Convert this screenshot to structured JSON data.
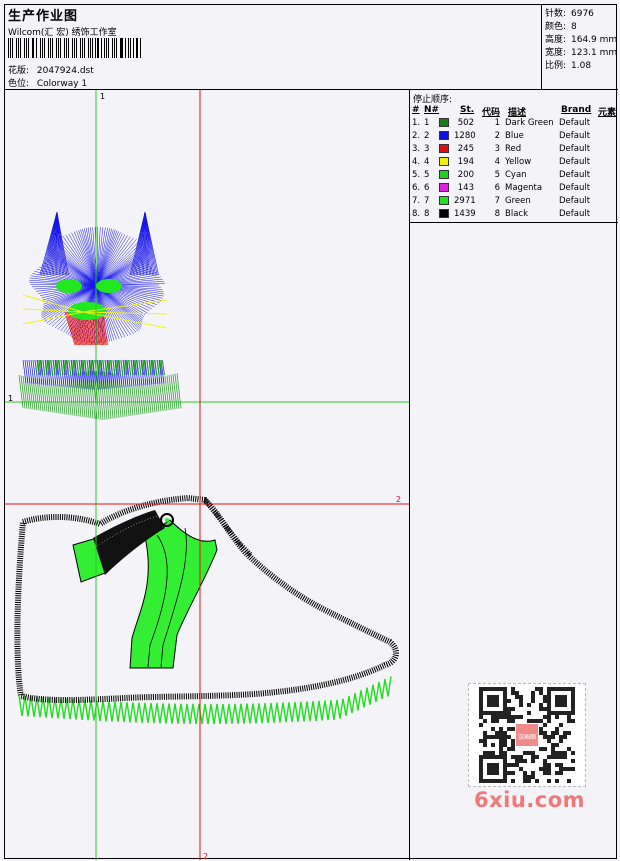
{
  "header": {
    "title": "生产作业图",
    "company": "Wilcom(汇 宏) 绣饰工作室",
    "file_label": "花版:",
    "file_value": "2047924.dst",
    "colorway_label": "色位:",
    "colorway_value": "Colorway 1"
  },
  "specs": [
    {
      "label": "针数:",
      "value": "6976"
    },
    {
      "label": "颜色:",
      "value": "8"
    },
    {
      "label": "高度:",
      "value": "164.9 mm"
    },
    {
      "label": "宽度:",
      "value": "123.1 mm"
    },
    {
      "label": "比例:",
      "value": "1.08"
    }
  ],
  "design": {
    "guide_labels": {
      "v1_top": "1",
      "h1_left": "1",
      "h2_right": "2",
      "v2_bottom": "2"
    }
  },
  "stop_sequence": {
    "title": "停止顺序:",
    "columns": {
      "num": "#",
      "needle": "N#",
      "stitches": "St.",
      "code": "代码",
      "desc": "描述",
      "brand": "Brand",
      "element": "元素"
    },
    "rows": [
      {
        "num": "1.",
        "needle": "1",
        "color": "#1a7a1a",
        "stitches": "502",
        "code": "1",
        "desc": "Dark Green",
        "brand": "Default"
      },
      {
        "num": "2.",
        "needle": "2",
        "color": "#1010e0",
        "stitches": "1280",
        "code": "2",
        "desc": "Blue",
        "brand": "Default"
      },
      {
        "num": "3.",
        "needle": "3",
        "color": "#e01010",
        "stitches": "245",
        "code": "3",
        "desc": "Red",
        "brand": "Default"
      },
      {
        "num": "4.",
        "needle": "4",
        "color": "#f0f010",
        "stitches": "194",
        "code": "4",
        "desc": "Yellow",
        "brand": "Default"
      },
      {
        "num": "5.",
        "needle": "5",
        "color": "#20d020",
        "stitches": "200",
        "code": "5",
        "desc": "Cyan",
        "brand": "Default"
      },
      {
        "num": "6.",
        "needle": "6",
        "color": "#e020e0",
        "stitches": "143",
        "code": "6",
        "desc": "Magenta",
        "brand": "Default"
      },
      {
        "num": "7.",
        "needle": "7",
        "color": "#20e020",
        "stitches": "2971",
        "code": "7",
        "desc": "Green",
        "brand": "Default"
      },
      {
        "num": "8.",
        "needle": "8",
        "color": "#000000",
        "stitches": "1439",
        "code": "8",
        "desc": "Black",
        "brand": "Default"
      }
    ]
  },
  "watermark": {
    "text": "6xiu.com",
    "qr_center": "汉画图"
  }
}
